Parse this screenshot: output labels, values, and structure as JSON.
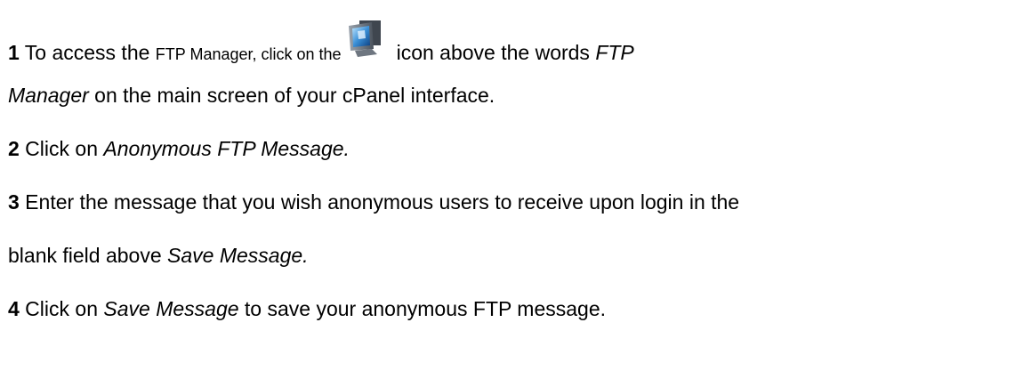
{
  "steps": [
    {
      "number": "1",
      "part_a": " To access the ",
      "part_b": "FTP Manager, click on the",
      "part_c": "icon above the words ",
      "part_d": "FTP",
      "part_e": "Manager",
      "part_f": " on the main screen of your cPanel interface.",
      "icon": "ftp-manager-monitor-icon"
    },
    {
      "number": "2",
      "text": " Click on ",
      "italic": "Anonymous FTP Message."
    },
    {
      "number": "3",
      "text": " Enter the message that you wish anonymous users to receive upon login in the",
      "cont": "blank field above ",
      "italic": "Save Message."
    },
    {
      "number": "4",
      "text": " Click on ",
      "italic": "Save Message",
      "tail": " to save your anonymous FTP message."
    }
  ]
}
